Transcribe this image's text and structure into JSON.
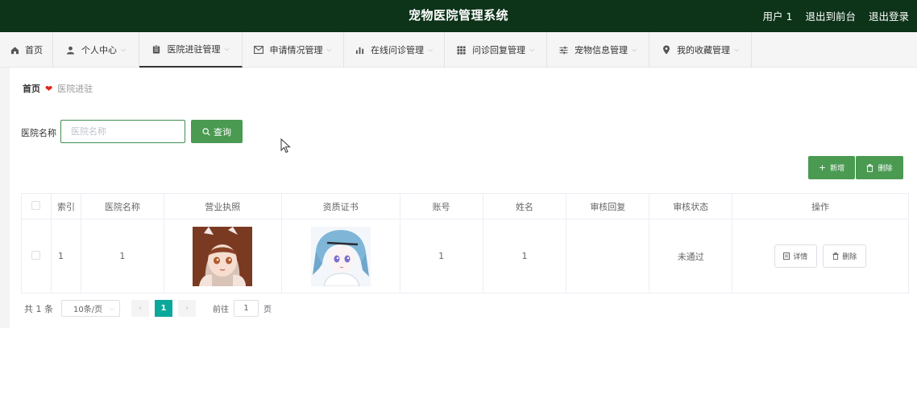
{
  "header": {
    "title": "宠物医院管理系统",
    "user": "用户 1",
    "front_link": "退出到前台",
    "logout": "退出登录",
    "bg_color": "#0d3319"
  },
  "nav": {
    "items": [
      {
        "label": "首页",
        "icon": "home-icon",
        "has_caret": false
      },
      {
        "label": "个人中心",
        "icon": "user-icon",
        "has_caret": true
      },
      {
        "label": "医院进驻管理",
        "icon": "clipboard-icon",
        "has_caret": true,
        "active": true
      },
      {
        "label": "申请情况管理",
        "icon": "mail-icon",
        "has_caret": true
      },
      {
        "label": "在线问诊管理",
        "icon": "bar-chart-icon",
        "has_caret": true
      },
      {
        "label": "问诊回复管理",
        "icon": "grid-icon",
        "has_caret": true
      },
      {
        "label": "宠物信息管理",
        "icon": "sliders-icon",
        "has_caret": true
      },
      {
        "label": "我的收藏管理",
        "icon": "location-pin-icon",
        "has_caret": true
      }
    ]
  },
  "breadcrumb": {
    "home": "首页",
    "current": "医院进驻",
    "separator_icon": "heart-icon"
  },
  "search": {
    "label": "医院名称",
    "placeholder": "医院名称",
    "value": "",
    "button": "查询"
  },
  "actions": {
    "add": "新增",
    "delete": "删除",
    "accent_color": "#4a9a52"
  },
  "table": {
    "columns": [
      "",
      "索引",
      "医院名称",
      "营业执照",
      "资质证书",
      "账号",
      "姓名",
      "审核回复",
      "审核状态",
      "操作"
    ],
    "rows": [
      {
        "index": "1",
        "name": "1",
        "license_image": "anime-girl-thumbnail",
        "certificate_image": "anime-girl-blue-hair-thumbnail",
        "account": "1",
        "real_name": "1",
        "reply": "",
        "status": "未通过",
        "detail_btn": "详情",
        "delete_btn": "删除"
      }
    ]
  },
  "pagination": {
    "total": "共 1 条",
    "page_size": "10条/页",
    "current_page": "1",
    "goto_label": "前往",
    "goto_value": "1",
    "goto_unit": "页",
    "active_color": "#0aa89b"
  }
}
